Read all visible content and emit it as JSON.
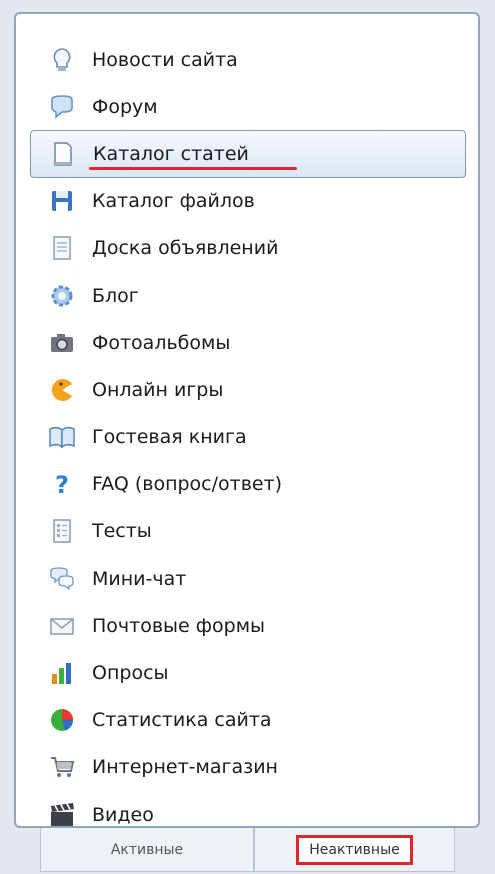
{
  "menu": {
    "items": [
      {
        "label": "Новости сайта",
        "icon": "lightbulb-icon"
      },
      {
        "label": "Форум",
        "icon": "speech-bubble-icon"
      },
      {
        "label": "Каталог статей",
        "icon": "document-icon",
        "selected": true
      },
      {
        "label": "Каталог файлов",
        "icon": "floppy-disk-icon"
      },
      {
        "label": "Доска объявлений",
        "icon": "notepad-icon"
      },
      {
        "label": "Блог",
        "icon": "gear-icon"
      },
      {
        "label": "Фотоальбомы",
        "icon": "camera-icon"
      },
      {
        "label": "Онлайн игры",
        "icon": "pacman-icon"
      },
      {
        "label": "Гостевая книга",
        "icon": "open-book-icon"
      },
      {
        "label": "FAQ (вопрос/ответ)",
        "icon": "question-mark-icon"
      },
      {
        "label": "Тесты",
        "icon": "checklist-icon"
      },
      {
        "label": "Мини-чат",
        "icon": "chat-bubbles-icon"
      },
      {
        "label": "Почтовые формы",
        "icon": "envelope-icon"
      },
      {
        "label": "Опросы",
        "icon": "bar-chart-icon"
      },
      {
        "label": "Статистика сайта",
        "icon": "pie-chart-icon"
      },
      {
        "label": "Интернет-магазин",
        "icon": "shopping-cart-icon"
      },
      {
        "label": "Видео",
        "icon": "clapperboard-icon"
      }
    ]
  },
  "tabs": {
    "active_label": "Активные",
    "inactive_label": "Неактивные"
  },
  "colors": {
    "highlight_red": "#e0262c",
    "panel_border": "#8fa6bf"
  }
}
